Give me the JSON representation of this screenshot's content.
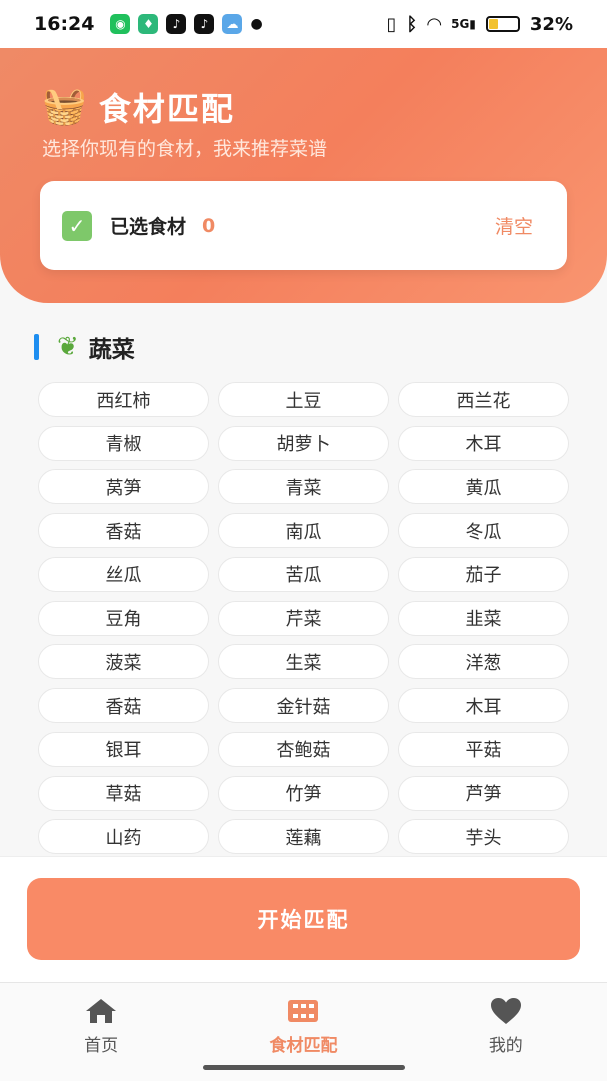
{
  "status": {
    "time": "16:24",
    "battery": "32%",
    "network": "5G"
  },
  "header": {
    "title": "食材匹配",
    "subtitle": "选择你现有的食材，我来推荐菜谱"
  },
  "selected": {
    "label": "已选食材",
    "count": "0",
    "clear": "清空"
  },
  "section": {
    "title": "蔬菜",
    "icon": "leafy-greens-icon"
  },
  "ingredients": [
    "西红柿",
    "土豆",
    "西兰花",
    "青椒",
    "胡萝卜",
    "木耳",
    "莴笋",
    "青菜",
    "黄瓜",
    "香菇",
    "南瓜",
    "冬瓜",
    "丝瓜",
    "苦瓜",
    "茄子",
    "豆角",
    "芹菜",
    "韭菜",
    "菠菜",
    "生菜",
    "洋葱",
    "香菇",
    "金针菇",
    "木耳",
    "银耳",
    "杏鲍菇",
    "平菇",
    "草菇",
    "竹笋",
    "芦笋",
    "山药",
    "莲藕",
    "芋头"
  ],
  "action": {
    "start": "开始匹配"
  },
  "tabs": [
    {
      "label": "首页",
      "icon": "home-icon"
    },
    {
      "label": "食材匹配",
      "icon": "grid-icon",
      "active": true
    },
    {
      "label": "我的",
      "icon": "heart-icon"
    }
  ],
  "colors": {
    "accent": "#f08a64",
    "header": "#f47f5c",
    "section_bar": "#1e8ef0"
  }
}
